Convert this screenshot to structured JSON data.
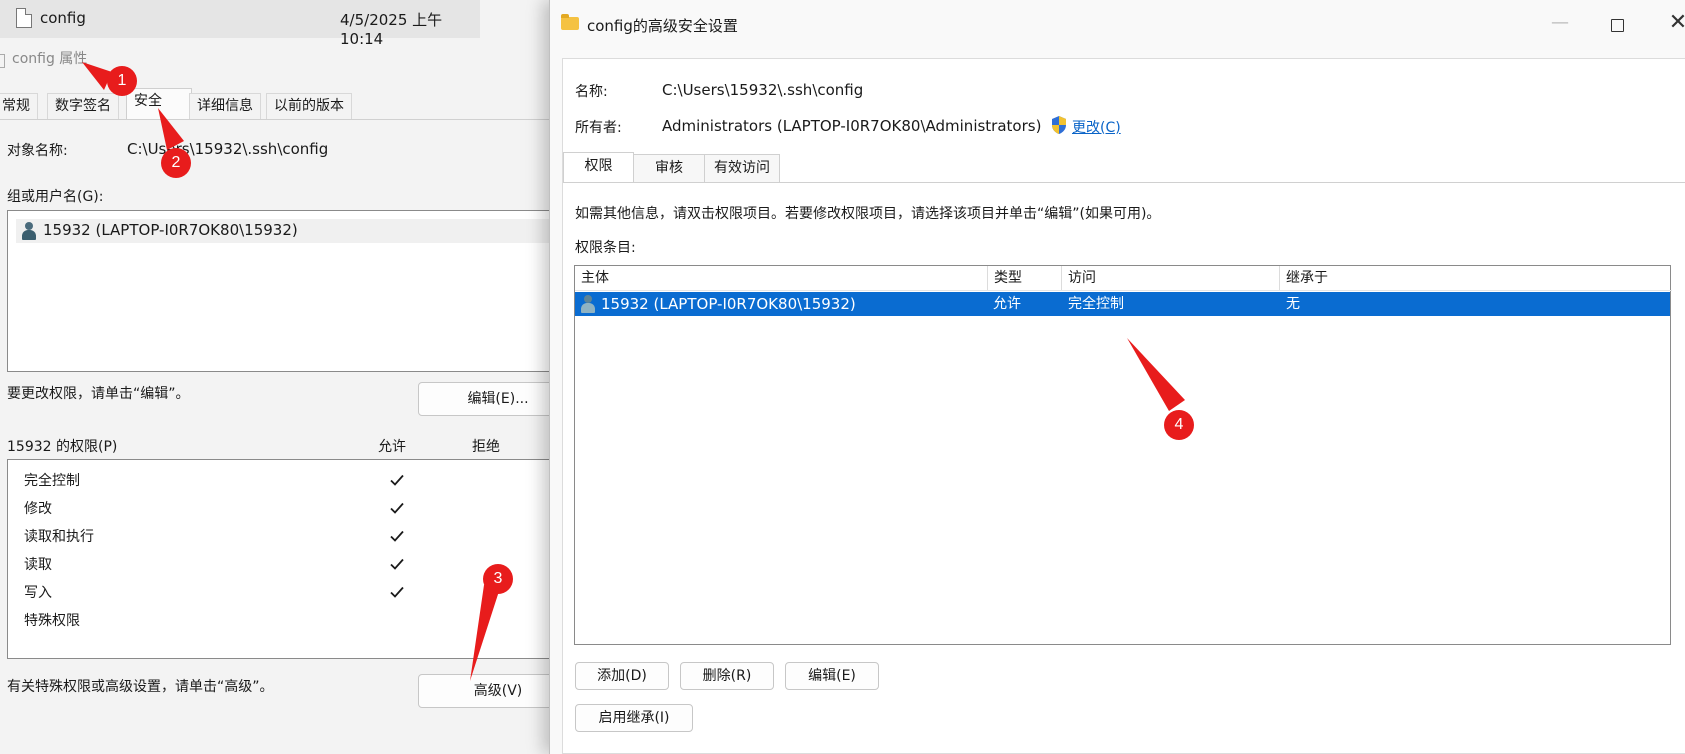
{
  "props": {
    "file_name": "config",
    "file_date": "4/5/2025 上午10:14",
    "title": "config 属性",
    "tabs": [
      "常规",
      "数字签名",
      "安全",
      "详细信息",
      "以前的版本"
    ],
    "object_label": "对象名称:",
    "object_value": "C:\\Users\\15932\\.ssh\\config",
    "group_label": "组或用户名(G):",
    "group_items": [
      "15932 (LAPTOP-I0R7OK80\\15932)"
    ],
    "change_hint": "要更改权限，请单击“编辑”。",
    "edit_button": "编辑(E)...",
    "perm_label": "15932 的权限(P)",
    "allow_header": "允许",
    "deny_header": "拒绝",
    "permissions": [
      {
        "name": "完全控制",
        "allow": true
      },
      {
        "name": "修改",
        "allow": true
      },
      {
        "name": "读取和执行",
        "allow": true
      },
      {
        "name": "读取",
        "allow": true
      },
      {
        "name": "写入",
        "allow": true
      },
      {
        "name": "特殊权限",
        "allow": false
      }
    ],
    "special_hint": "有关特殊权限或高级设置，请单击“高级”。",
    "advanced_button": "高级(V)"
  },
  "adv": {
    "title": "config的高级安全设置",
    "min_glyph": "—",
    "close_glyph": "✕",
    "name_label": "名称:",
    "name_value": "C:\\Users\\15932\\.ssh\\config",
    "owner_label": "所有者:",
    "owner_value": "Administrators (LAPTOP-I0R7OK80\\Administrators)",
    "change_link": "更改(C)",
    "tabs": [
      "权限",
      "审核",
      "有效访问"
    ],
    "info_text": "如需其他信息，请双击权限项目。若要修改权限项目，请选择该项目并单击“编辑”(如果可用)。",
    "entries_label": "权限条目:",
    "columns": [
      "主体",
      "类型",
      "访问",
      "继承于"
    ],
    "rows": [
      {
        "principal": "15932 (LAPTOP-I0R7OK80\\15932)",
        "type": "允许",
        "access": "完全控制",
        "inherited": "无"
      }
    ],
    "add_button": "添加(D)",
    "remove_button": "删除(R)",
    "edit_button": "编辑(E)",
    "inherit_button": "启用继承(I)"
  },
  "markers": [
    "1",
    "2",
    "3",
    "4"
  ],
  "colors": {
    "selection": "#0a6cd1",
    "marker": "#e81c1c",
    "link": "#0a64c8",
    "folder": "#f5c242"
  }
}
